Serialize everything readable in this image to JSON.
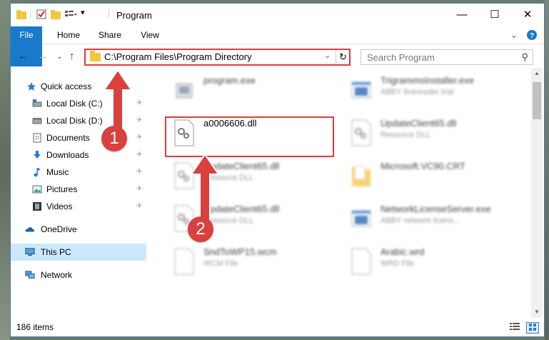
{
  "window": {
    "title": "Program",
    "minimize_label": "—",
    "maximize_label": "☐",
    "close_label": "✕"
  },
  "ribbon": {
    "tabs": [
      "File",
      "Home",
      "Share",
      "View"
    ],
    "collapse_label": "⌄",
    "help_label": "?"
  },
  "nav": {
    "back": "←",
    "forward": "→",
    "recent": "⌄",
    "up": "↑"
  },
  "address": {
    "path": "C:\\Program Files\\Program Directory",
    "dropdown": "⌄",
    "refresh": "↻"
  },
  "search": {
    "placeholder": "Search Program",
    "icon_glyph": "⚲"
  },
  "sidebar": {
    "items": [
      {
        "label": "Quick access",
        "icon": "star-icon",
        "pinned": false
      },
      {
        "label": "Local Disk (C:)",
        "icon": "drive-icon",
        "pinned": true
      },
      {
        "label": "Local Disk (D:)",
        "icon": "drive-icon",
        "pinned": true
      },
      {
        "label": "Documents",
        "icon": "documents-icon",
        "pinned": true
      },
      {
        "label": "Downloads",
        "icon": "download-icon",
        "pinned": true
      },
      {
        "label": "Music",
        "icon": "music-icon",
        "pinned": true
      },
      {
        "label": "Pictures",
        "icon": "pictures-icon",
        "pinned": true
      },
      {
        "label": "Videos",
        "icon": "videos-icon",
        "pinned": true
      },
      {
        "label": "OneDrive",
        "icon": "cloud-icon",
        "pinned": false
      },
      {
        "label": "This PC",
        "icon": "computer-icon",
        "pinned": false,
        "selected": true
      },
      {
        "label": "Network",
        "icon": "network-icon",
        "pinned": false
      }
    ],
    "pin_glyph": "📌"
  },
  "files": [
    {
      "name": "program.exe",
      "type": "",
      "icon": "exe-icon"
    },
    {
      "name": "TrigrammsInstaller.exe",
      "type": "ABBY finereader trial",
      "icon": "app-window-icon"
    },
    {
      "name": "a0006606.dll",
      "type": "",
      "icon": "dll-gear-icon",
      "highlighted": true
    },
    {
      "name": "UpdateClient65.dll",
      "type": "Resource DLL",
      "icon": "dll-gear-icon"
    },
    {
      "name": "UpdateClient65.dll",
      "type": "Resource DLL",
      "icon": "dll-gear-icon"
    },
    {
      "name": "Microsoft.VC90.CRT",
      "type": "",
      "icon": "folder-icon"
    },
    {
      "name": "UpdateClient65.dll",
      "type": "Resource DLL",
      "icon": "dll-gear-icon"
    },
    {
      "name": "NetworkLicenseServer.exe",
      "type": "ABBY network licens...",
      "icon": "app-window-icon"
    },
    {
      "name": "SndToWP15.wcm",
      "type": "WCM File",
      "icon": "blank-file-icon"
    },
    {
      "name": "Arabic.wrd",
      "type": "WRD File",
      "icon": "blank-file-icon"
    }
  ],
  "status": {
    "count": "186 items"
  },
  "annotations": {
    "step1": "1",
    "step2": "2",
    "color": "#d94040"
  },
  "colors": {
    "accent": "#1979ca",
    "highlight": "#e03a3c",
    "selected_bg": "#cce8ff"
  }
}
